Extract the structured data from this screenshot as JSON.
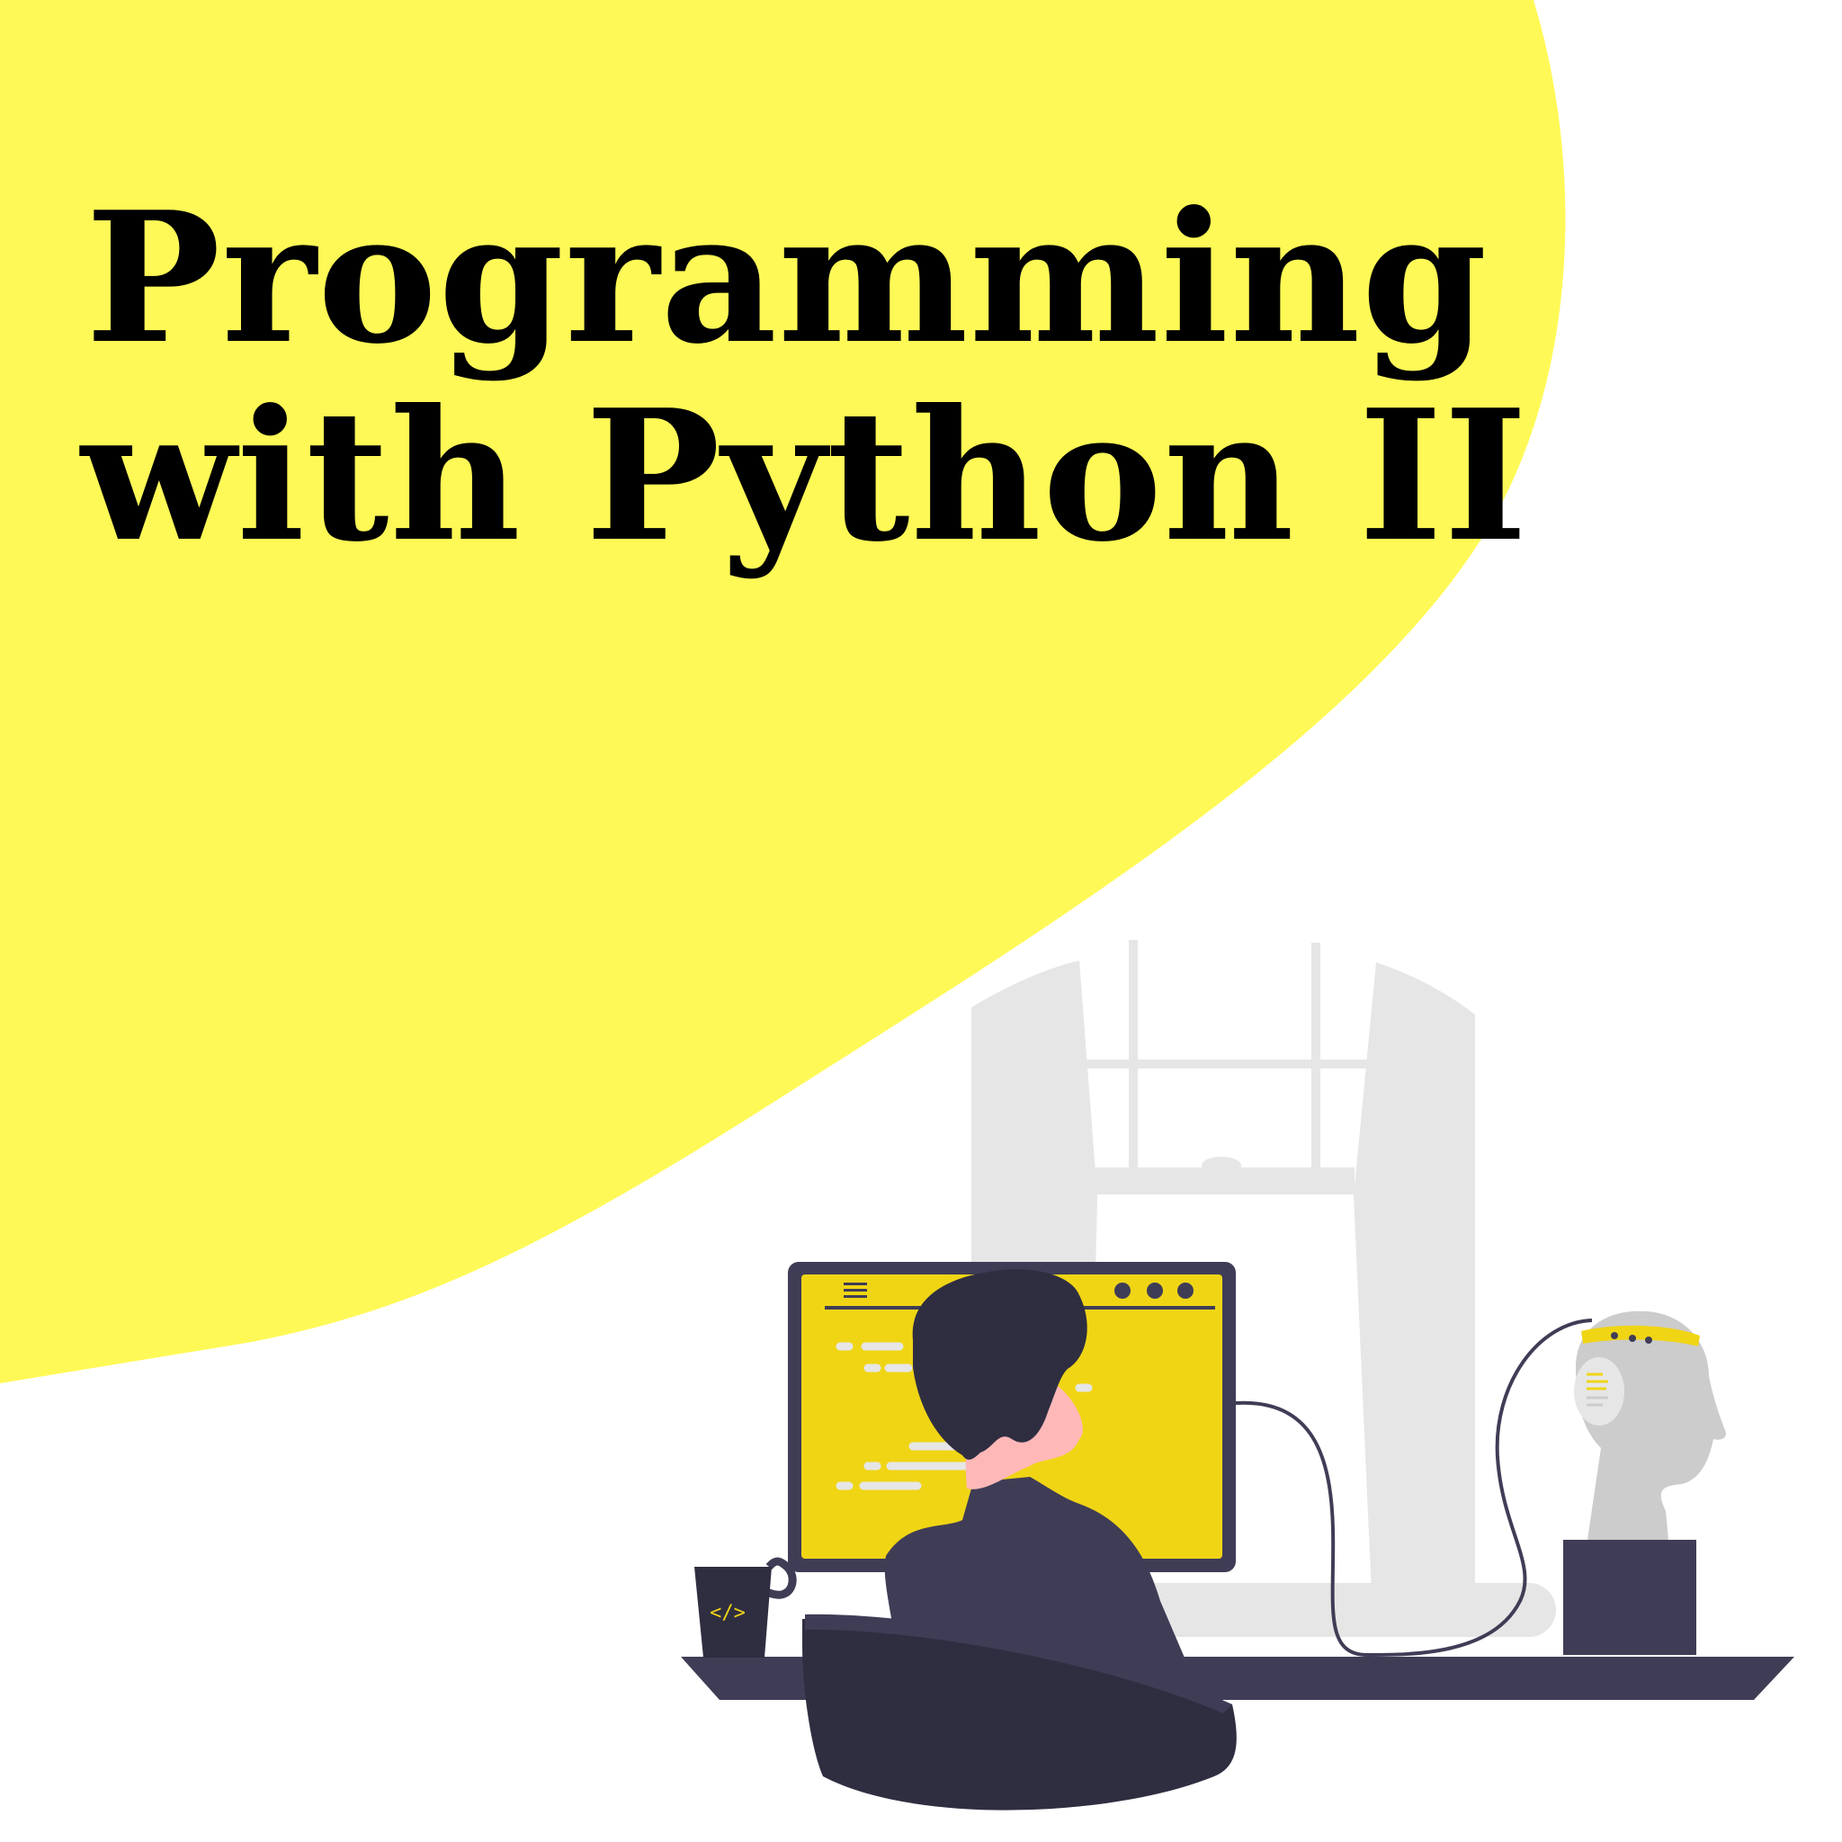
{
  "title": {
    "line1": "Programming",
    "line2": "with Python II"
  },
  "illustration": {
    "mug_icon_text": "</>",
    "subject": "person coding at desk with monitor, mug, bust with headset, window"
  },
  "colors": {
    "background": "#ffffff",
    "yellow_blob": "#fff957",
    "screen": "#f0d515",
    "frame": "#3f3d56",
    "hair": "#2f2e41",
    "skin": "#ffb8b8",
    "shirt": "#3f3d56",
    "window_gray": "#e6e6e6",
    "bust_gray": "#cccccc",
    "code_lines": "#e6e6e6",
    "title_text": "#000000"
  }
}
